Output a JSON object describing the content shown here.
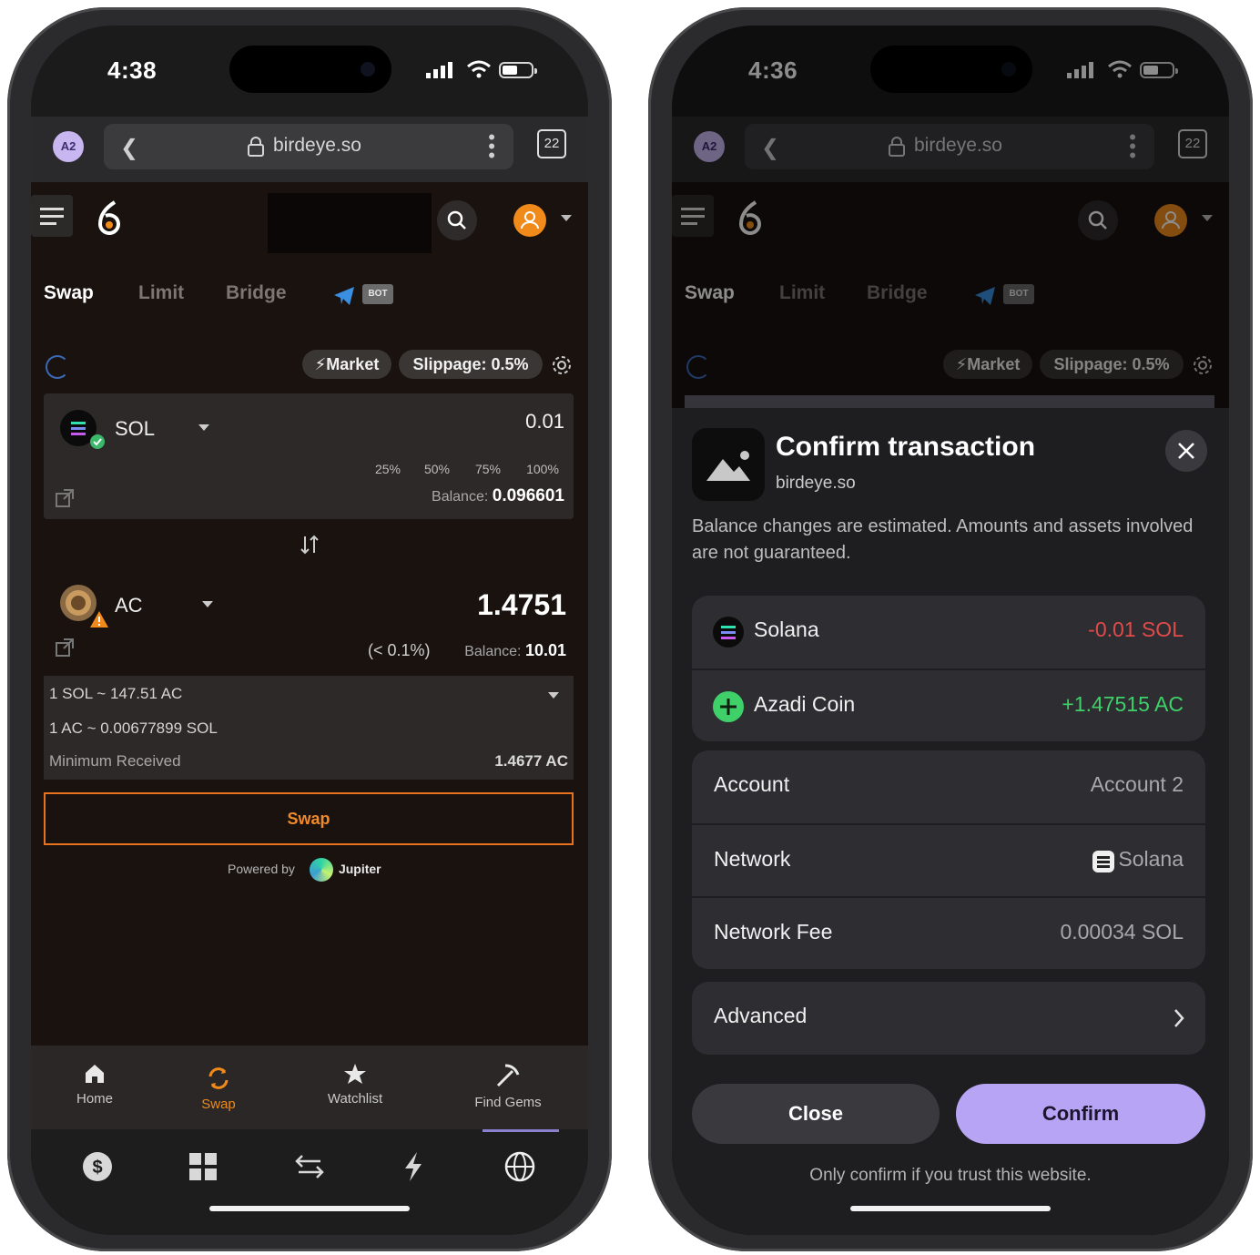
{
  "left": {
    "status": {
      "time": "4:38"
    },
    "browser": {
      "avatar": "A2",
      "url": "birdeye.so",
      "tab_count": "22"
    },
    "tabs": [
      "Swap",
      "Limit",
      "Bridge"
    ],
    "bot_badge": "BOT",
    "order_type": "Market",
    "slippage": "Slippage: 0.5%",
    "from": {
      "token": "SOL",
      "amount": "0.01",
      "percents": [
        "25%",
        "50%",
        "75%",
        "100%"
      ],
      "balance_label": "Balance:",
      "balance": "0.096601"
    },
    "to": {
      "token": "AC",
      "amount": "1.4751",
      "impact": "(< 0.1%)",
      "balance_label": "Balance:",
      "balance": "10.01"
    },
    "quote": {
      "rate1": "1 SOL ~ 147.51 AC",
      "rate2": "1 AC ~ 0.00677899 SOL",
      "min_label": "Minimum Received",
      "min_value": "1.4677 AC"
    },
    "swap_button": "Swap",
    "powered_by": "Powered by",
    "powered_name": "Jupiter",
    "bottom_nav": [
      "Home",
      "Swap",
      "Watchlist",
      "Find Gems"
    ],
    "accent": "#e8731f"
  },
  "right": {
    "status": {
      "time": "4:36"
    },
    "browser": {
      "avatar": "A2",
      "url": "birdeye.so",
      "tab_count": "22"
    },
    "tabs": [
      "Swap",
      "Limit",
      "Bridge"
    ],
    "bot_badge": "BOT",
    "order_type": "Market",
    "slippage": "Slippage: 0.5%",
    "sheet": {
      "title": "Confirm transaction",
      "site": "birdeye.so",
      "note": "Balance changes are estimated. Amounts and assets involved are not guaranteed.",
      "changes": [
        {
          "asset": "Solana",
          "change": "-0.01 SOL",
          "color": "#e24a4a"
        },
        {
          "asset": "Azadi Coin",
          "change": "+1.47515 AC",
          "color": "#3fd06a"
        }
      ],
      "details": [
        {
          "label": "Account",
          "value": "Account 2"
        },
        {
          "label": "Network",
          "value": "Solana"
        },
        {
          "label": "Network Fee",
          "value": "0.00034 SOL"
        }
      ],
      "advanced": "Advanced",
      "close": "Close",
      "confirm": "Confirm",
      "trust": "Only confirm if you trust this website.",
      "confirm_color": "#b7a4f4"
    }
  }
}
